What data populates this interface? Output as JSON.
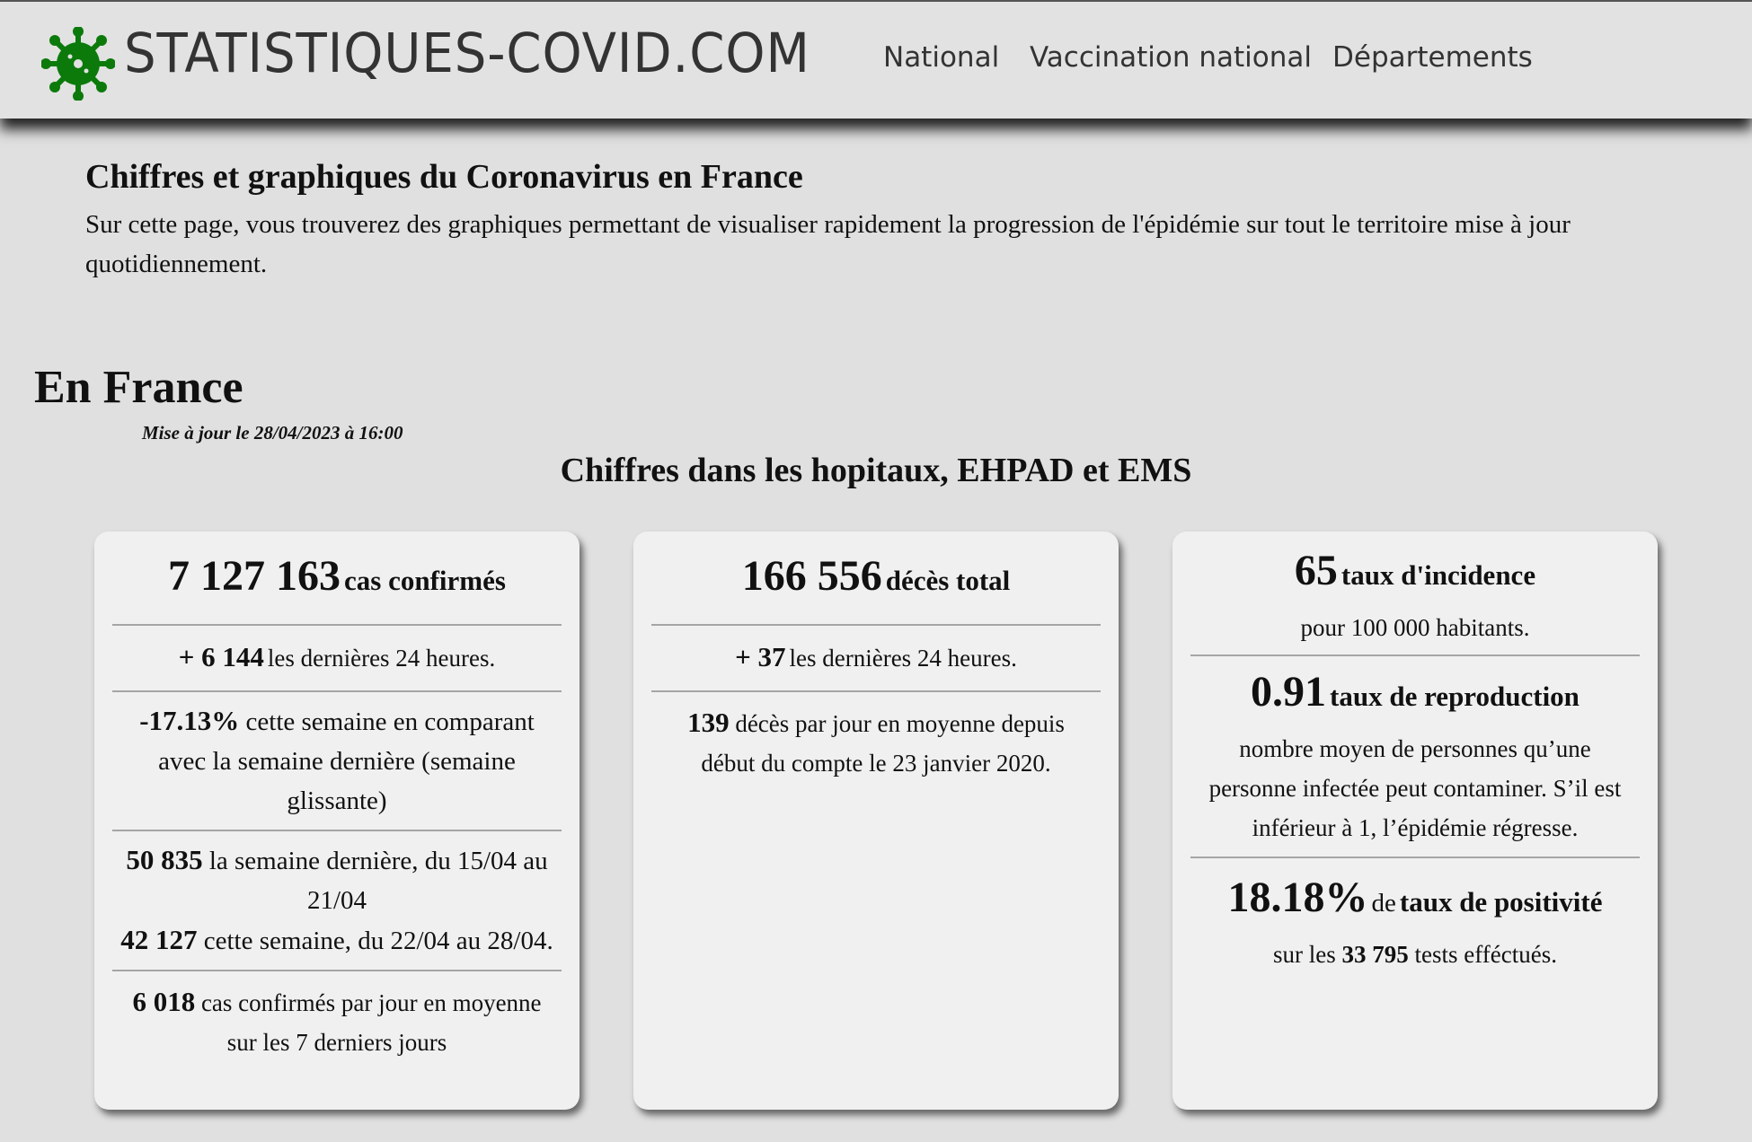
{
  "header": {
    "site_title": "STATISTIQUES-COVID.COM",
    "logo_color": "#0b7a0b",
    "nav": [
      "National",
      "Vaccination national",
      "Départements"
    ]
  },
  "intro": {
    "title": "Chiffres et graphiques du Coronavirus en France",
    "text": "Sur cette page, vous trouverez des graphiques permettant de visualiser rapidement la progression de l'épidémie sur tout le territoire mise à jour quotidiennement."
  },
  "section": {
    "title": "En France",
    "updated": "Mise à jour le 28/04/2023 à 16:00",
    "subtitle": "Chiffres dans les hopitaux, EHPAD et EMS"
  },
  "cases": {
    "total": "7 127 163",
    "total_label": "cas confirmés",
    "daily_prefix": "+ ",
    "daily": "6 144",
    "daily_label": "les dernières 24 heures.",
    "change": "-17.13%",
    "change_label": "cette semaine en comparant avec la semaine dernière (semaine glissante)",
    "last_week": "50 835",
    "last_week_label": "la semaine dernière, du 15/04 au 21/04",
    "this_week": "42 127",
    "this_week_label": "cette semaine, du 22/04 au 28/04.",
    "avg": "6 018",
    "avg_label": "cas confirmés par jour en moyenne sur les 7 derniers jours"
  },
  "deaths": {
    "total": "166 556",
    "total_label": "décès total",
    "daily_prefix": "+ ",
    "daily": "37",
    "daily_label": "les dernières 24 heures.",
    "avg": "139",
    "avg_label": "décès par jour en moyenne depuis début du compte le 23 janvier 2020."
  },
  "rates": {
    "incidence": "65",
    "incidence_label": "taux d'incidence",
    "incidence_sub": "pour 100 000 habitants.",
    "reproduction": "0.91",
    "reproduction_label": "taux de reproduction",
    "reproduction_sub": "nombre moyen de personnes qu’une personne infectée peut contaminer. S’il est inférieur à 1, l’épidémie régresse.",
    "positivity": "18.18%",
    "positivity_mid": "de",
    "positivity_label": "taux de positivité",
    "tests_prefix": "sur les",
    "tests": "33 795",
    "tests_suffix": "tests efféctués."
  }
}
